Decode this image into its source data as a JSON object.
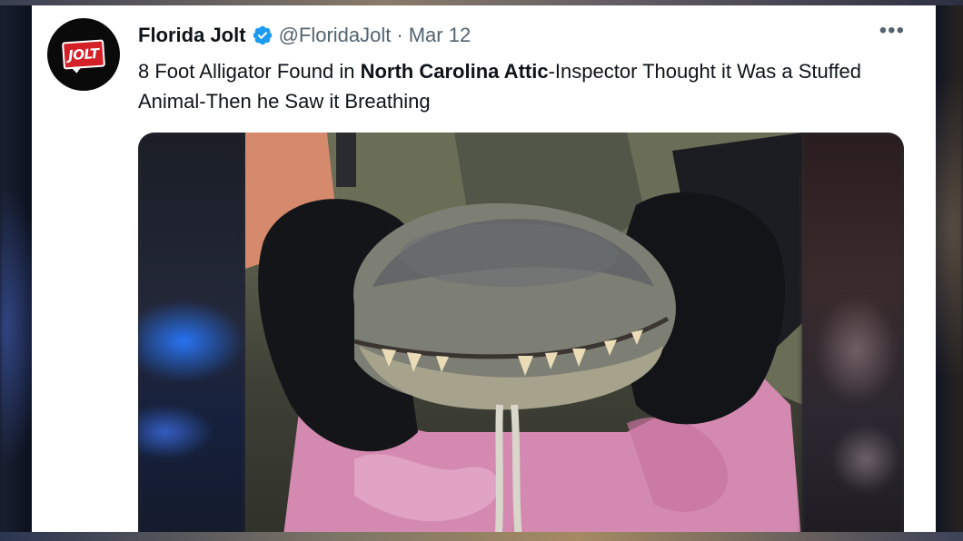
{
  "tweet": {
    "display_name": "Florida Jolt",
    "handle": "@FloridaJolt",
    "separator": "·",
    "date": "Mar 12",
    "more_label": "•••",
    "avatar_text": "JOLT",
    "text_part1": "8 Foot Alligator Found in ",
    "text_bold": "North Carolina Attic",
    "text_part2": "-Inspector Thought it Was a Stuffed Animal-Then he Saw it Breathing",
    "verified": true
  },
  "colors": {
    "verified_blue": "#1d9bf0",
    "text_primary": "#0f1419",
    "text_secondary": "#536471",
    "brand_red": "#d42027"
  },
  "icons": {
    "verified": "verified-badge-icon",
    "more": "more-options-icon"
  }
}
